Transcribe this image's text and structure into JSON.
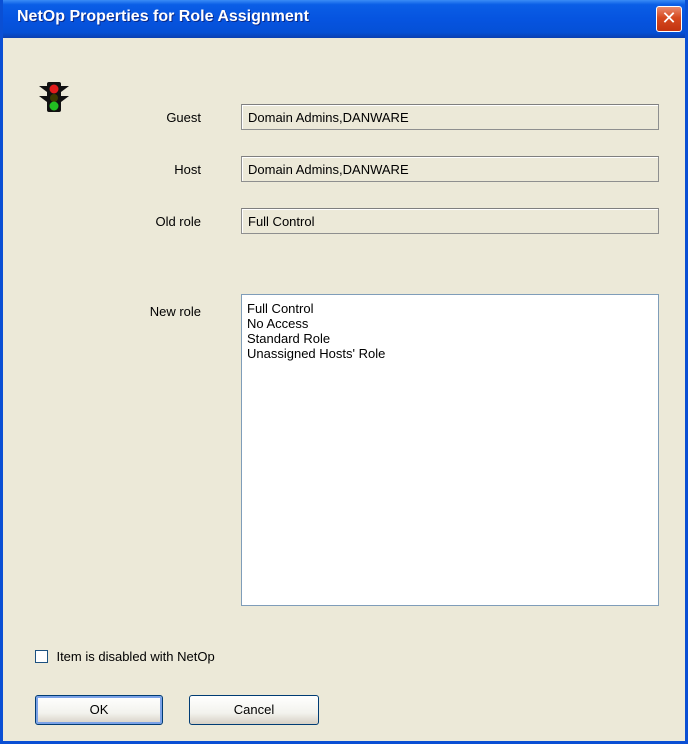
{
  "window": {
    "title": "NetOp Properties for Role Assignment",
    "close_glyph": "✕"
  },
  "fields": {
    "guest": {
      "label": "Guest",
      "value": "Domain Admins,DANWARE"
    },
    "host": {
      "label": "Host",
      "value": "Domain Admins,DANWARE"
    },
    "old_role": {
      "label": "Old role",
      "value": "Full Control"
    }
  },
  "new_role": {
    "label": "New role",
    "options": [
      "Full Control",
      "No Access",
      "Standard Role",
      "Unassigned Hosts' Role"
    ]
  },
  "checkbox": {
    "label": "Item is disabled with NetOp",
    "checked": false
  },
  "buttons": {
    "ok": "OK",
    "cancel": "Cancel"
  },
  "icons": {
    "app_icon": "traffic-light-icon"
  },
  "colors": {
    "titlebar": "#0654e0",
    "close": "#d6491f",
    "dialog_bg": "#ece9d8"
  }
}
